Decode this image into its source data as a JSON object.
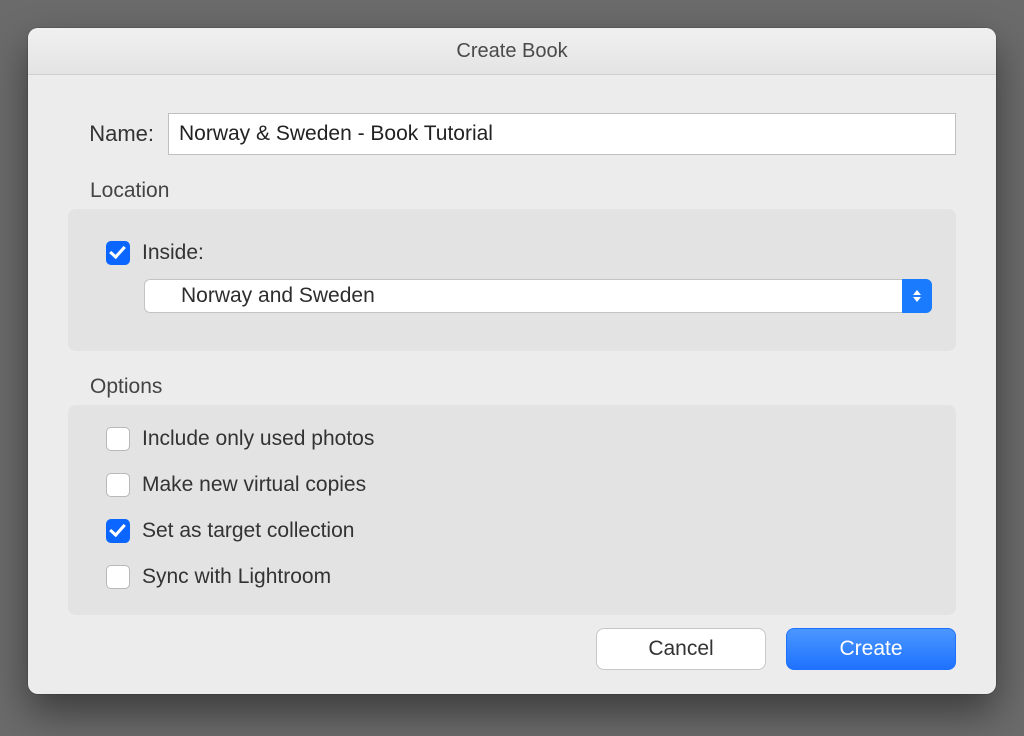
{
  "dialog": {
    "title": "Create Book",
    "name_label": "Name:",
    "name_value": "Norway & Sweden - Book Tutorial"
  },
  "location": {
    "section_label": "Location",
    "inside_checked": true,
    "inside_label": "Inside:",
    "select_value": "Norway and Sweden"
  },
  "options": {
    "section_label": "Options",
    "items": [
      {
        "label": "Include only used photos",
        "checked": false
      },
      {
        "label": "Make new virtual copies",
        "checked": false
      },
      {
        "label": "Set as target collection",
        "checked": true
      },
      {
        "label": "Sync with Lightroom",
        "checked": false
      }
    ]
  },
  "buttons": {
    "cancel": "Cancel",
    "create": "Create"
  }
}
